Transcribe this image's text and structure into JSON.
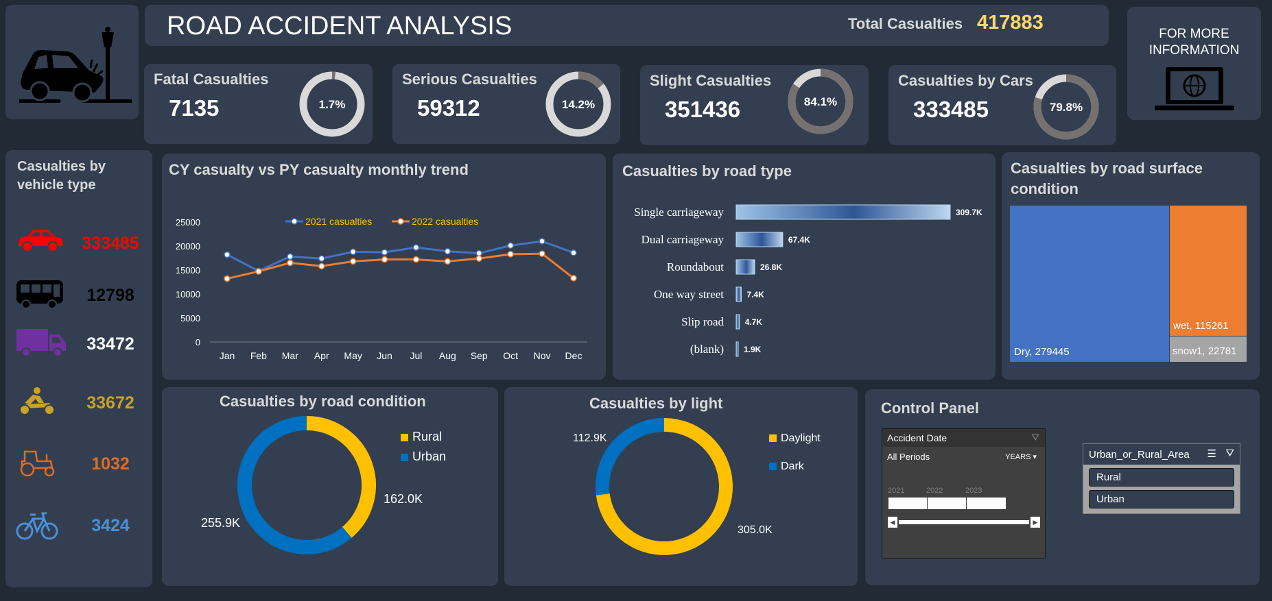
{
  "header": {
    "title": "ROAD ACCIDENT ANALYSIS",
    "total_label": "Total Casualties",
    "total_value": "417883",
    "more_info": "FOR MORE INFORMATION"
  },
  "colors": {
    "background": "#222a35",
    "panel": "#333f50",
    "accent_yellow": "#ffd966",
    "blue": "#4472c4",
    "orange": "#ed7d31",
    "gold": "#ffc000",
    "urban_blue": "#0070c0"
  },
  "kpis": [
    {
      "label": "Fatal Casualties",
      "value": "7135",
      "pct_label": "1.7%",
      "pct": 1.7
    },
    {
      "label": "Serious Casualties",
      "value": "59312",
      "pct_label": "14.2%",
      "pct": 14.2
    },
    {
      "label": "Slight Casualties",
      "value": "351436",
      "pct_label": "84.1%",
      "pct": 84.1
    },
    {
      "label": "Casualties by Cars",
      "value": "333485",
      "pct_label": "79.8%",
      "pct": 79.8
    }
  ],
  "vehicles": {
    "title": "Casualties by vehicle type",
    "items": [
      {
        "icon": "car-icon",
        "value": "333485",
        "color": "#ff0000"
      },
      {
        "icon": "bus-icon",
        "value": "12798",
        "color": "#000000"
      },
      {
        "icon": "van-icon",
        "value": "33472",
        "color": "#ffffff"
      },
      {
        "icon": "motorcycle-icon",
        "value": "33672",
        "color": "#c9a227"
      },
      {
        "icon": "tractor-icon",
        "value": "1032",
        "color": "#e06c25"
      },
      {
        "icon": "bicycle-icon",
        "value": "3424",
        "color": "#4a90d9"
      }
    ]
  },
  "trend": {
    "title": "CY casualty vs PY casualty monthly trend",
    "legend": [
      "2021 casualties",
      "2022 casualties"
    ]
  },
  "road_type": {
    "title": "Casualties by road type"
  },
  "surface": {
    "title": "Casualties by road surface condition",
    "items": [
      {
        "label": "Dry, 279445",
        "value": 279445,
        "color": "#4472c4"
      },
      {
        "label": "wet, 115261",
        "value": 115261,
        "color": "#ed7d31"
      },
      {
        "label": "snow1, 22781",
        "value": 22781,
        "color": "#a5a5a5"
      }
    ]
  },
  "road_condition": {
    "title": "Casualties by road condition",
    "legend": [
      "Rural",
      "Urban"
    ],
    "labels": [
      "162.0K",
      "255.9K"
    ]
  },
  "light": {
    "title": "Casualties by light",
    "legend": [
      "Daylight",
      "Dark"
    ],
    "labels": [
      "305.0K",
      "112.9K"
    ]
  },
  "control": {
    "title": "Control Panel",
    "date_slicer": {
      "title": "Accident Date",
      "periods": "All Periods",
      "unit": "YEARS",
      "years": [
        "2021",
        "2022",
        "2023"
      ]
    },
    "area_slicer": {
      "title": "Urban_or_Rural_Area",
      "options": [
        "Rural",
        "Urban"
      ]
    }
  },
  "chart_data": [
    {
      "type": "line",
      "title": "CY casualty vs PY casualty monthly trend",
      "categories": [
        "Jan",
        "Feb",
        "Mar",
        "Apr",
        "May",
        "Jun",
        "Jul",
        "Aug",
        "Sep",
        "Oct",
        "Nov",
        "Dec"
      ],
      "yticks": [
        "0",
        "5000",
        "10000",
        "15000",
        "20000",
        "25000"
      ],
      "ylim": [
        0,
        25000
      ],
      "series": [
        {
          "name": "2021 casualties",
          "color": "#4472c4",
          "values": [
            18200,
            14800,
            17800,
            17400,
            18800,
            18700,
            19700,
            18900,
            18500,
            20100,
            21000,
            18600
          ]
        },
        {
          "name": "2022 casualties",
          "color": "#ed7d31",
          "values": [
            13200,
            14700,
            16500,
            15800,
            16800,
            17200,
            17200,
            16800,
            17400,
            18300,
            18400,
            13300
          ]
        }
      ]
    },
    {
      "type": "bar",
      "title": "Casualties by road type",
      "categories": [
        "Single carriageway",
        "Dual carriageway",
        "Roundabout",
        "One way street",
        "Slip road",
        "(blank)"
      ],
      "values": [
        309.7,
        67.4,
        26.8,
        7.4,
        4.7,
        1.9
      ],
      "value_labels": [
        "309.7K",
        "67.4K",
        "26.8K",
        "7.4K",
        "4.7K",
        "1.9K"
      ]
    },
    {
      "type": "pie",
      "title": "Casualties by road condition",
      "categories": [
        "Rural",
        "Urban"
      ],
      "values": [
        162.0,
        255.9
      ],
      "colors": [
        "#ffc000",
        "#0070c0"
      ]
    },
    {
      "type": "pie",
      "title": "Casualties by light",
      "categories": [
        "Daylight",
        "Dark"
      ],
      "values": [
        305.0,
        112.9
      ],
      "colors": [
        "#ffc000",
        "#0070c0"
      ]
    }
  ]
}
